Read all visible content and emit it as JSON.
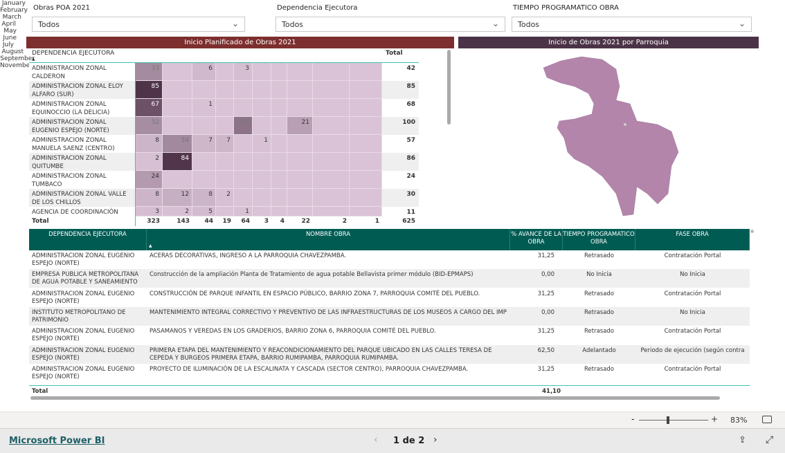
{
  "slicers": [
    {
      "label": "Obras POA 2021",
      "value": "Todos"
    },
    {
      "label": "Dependencia Ejecutora",
      "value": "Todos"
    },
    {
      "label": "TIEMPO PROGRAMATICO OBRA",
      "value": "Todos"
    }
  ],
  "matrix": {
    "title": "Inicio Planificado de Obras 2021",
    "title_color": "#7d2e2e",
    "row_header": "DEPENDENCIA EJECUTORA",
    "months": [
      "January",
      "February",
      "March",
      "April",
      "May",
      "June",
      "July",
      "August",
      "September",
      "November"
    ],
    "total_label": "Total",
    "rows": [
      {
        "name": "ADMINISTRACION ZONAL CALDERON",
        "values": [
          33,
          null,
          6,
          null,
          3,
          null,
          null,
          null,
          null,
          null
        ],
        "total": "42"
      },
      {
        "name": "ADMINISTRACION ZONAL ELOY ALFARO (SUR)",
        "values": [
          85,
          null,
          null,
          null,
          null,
          null,
          null,
          null,
          null,
          null
        ],
        "total": "85"
      },
      {
        "name": "ADMINISTRACION ZONAL EQUINOCCIO (LA DELICIA)",
        "values": [
          67,
          null,
          1,
          null,
          null,
          null,
          null,
          null,
          null,
          null
        ],
        "total": "68"
      },
      {
        "name": "ADMINISTRACION ZONAL EUGENIO ESPEJO (NORTE)",
        "values": [
          32,
          null,
          null,
          null,
          47,
          null,
          null,
          21,
          null,
          null
        ],
        "total": "100"
      },
      {
        "name": "ADMINISTRACION ZONAL MANUELA SAENZ (CENTRO)",
        "values": [
          8,
          34,
          7,
          7,
          null,
          1,
          null,
          null,
          null,
          null
        ],
        "total": "57"
      },
      {
        "name": "ADMINISTRACION ZONAL QUITUMBE",
        "values": [
          2,
          84,
          null,
          null,
          null,
          null,
          null,
          null,
          null,
          null
        ],
        "total": "86"
      },
      {
        "name": "ADMINISTRACION ZONAL TUMBACO",
        "values": [
          24,
          null,
          null,
          null,
          null,
          null,
          null,
          null,
          null,
          null
        ],
        "total": "24"
      },
      {
        "name": "ADMINISTRACION ZONAL VALLE DE LOS CHILLOS",
        "values": [
          8,
          12,
          8,
          2,
          null,
          null,
          null,
          null,
          null,
          null
        ],
        "total": "30"
      },
      {
        "name": "AGENCIA DE COORDINACIÓN",
        "values": [
          3,
          2,
          5,
          null,
          1,
          null,
          null,
          null,
          null,
          null
        ],
        "total": "11"
      }
    ],
    "totals": [
      "323",
      "143",
      "44",
      "19",
      "64",
      "3",
      "4",
      "22",
      "2",
      "1"
    ],
    "grand_total": "625"
  },
  "map": {
    "title": "Inicio de Obras 2021 por Parroquia",
    "title_color": "#4b3347",
    "fill": "#b385ab"
  },
  "table": {
    "headers": [
      "DEPENDENCIA EJECUTORA",
      "NOMBRE OBRA",
      "% AVANCE DE LA OBRA",
      "TIEMPO PROGRAMATICO OBRA",
      "FASE OBRA"
    ],
    "header_color": "#005c53",
    "rows": [
      [
        "ADMINISTRACION ZONAL EUGENIO ESPEJO (NORTE)",
        "ACERAS DECORATIVAS, INGRESO A LA PARROQUIA CHAVEZPAMBA.",
        "31,25",
        "Retrasado",
        "Contratación Portal"
      ],
      [
        "EMPRESA PUBLICA METROPOLITANA DE AGUA POTABLE Y SANEAMIENTO",
        "Construcción de la ampliación Planta de Tratamiento de agua potable Bellavista primer módulo (BID-EPMAPS)",
        "0,00",
        "No Inicia",
        "No Inicia"
      ],
      [
        "ADMINISTRACION ZONAL EUGENIO ESPEJO (NORTE)",
        "CONSTRUCCIÓN DE PARQUE INFANTIL EN ESPACIO PÚBLICO, BARRIO ZONA 7, PARROQUIA COMITÉ DEL PUEBLO.",
        "31,25",
        "Retrasado",
        "Contratación Portal"
      ],
      [
        "INSTITUTO METROPOLITANO DE PATRIMONIO",
        "MANTENIMIENTO INTEGRAL CORRECTIVO Y PREVENTIVO DE LAS INFRAESTRUCTURAS DE LOS MUSEOS A CARGO DEL IMP",
        "0,00",
        "Retrasado",
        "No Inicia"
      ],
      [
        "ADMINISTRACION ZONAL EUGENIO ESPEJO (NORTE)",
        "PASAMANOS Y VEREDAS EN LOS GRADERIOS, BARRIO ZONA 6, PARROQUIA COMITÉ DEL PUEBLO.",
        "31,25",
        "Retrasado",
        "Contratación Portal"
      ],
      [
        "ADMINISTRACION ZONAL EUGENIO ESPEJO (NORTE)",
        "PRIMERA ETAPA DEL MANTENIMIENTO Y REACONDICIONAMIENTO DEL PARQUE UBICADO EN LAS CALLES TERESA DE CEPEDA Y BURGEOS PRIMERA ETAPA, BARRIO RUMIPAMBA, PARROQUIA RUMIPAMBA.",
        "62,50",
        "Adelantado",
        "Periodo de ejecución (según contra"
      ],
      [
        "ADMINISTRACION ZONAL EUGENIO ESPEJO (NORTE)",
        "PROYECTO DE ILUMINACIÓN DE LA ESCALINATA Y CASCADA (SECTOR CENTRO), PARROQUIA CHAVEZPAMBA.",
        "31,25",
        "Retrasado",
        "Contratación Portal"
      ]
    ],
    "total_label": "Total",
    "total_avance": "41,10"
  },
  "zoom": {
    "minus": "-",
    "plus": "+",
    "level": "83%",
    "slider_percent": 50
  },
  "footer": {
    "brand": "Microsoft Power BI",
    "page": "1 de 2"
  }
}
